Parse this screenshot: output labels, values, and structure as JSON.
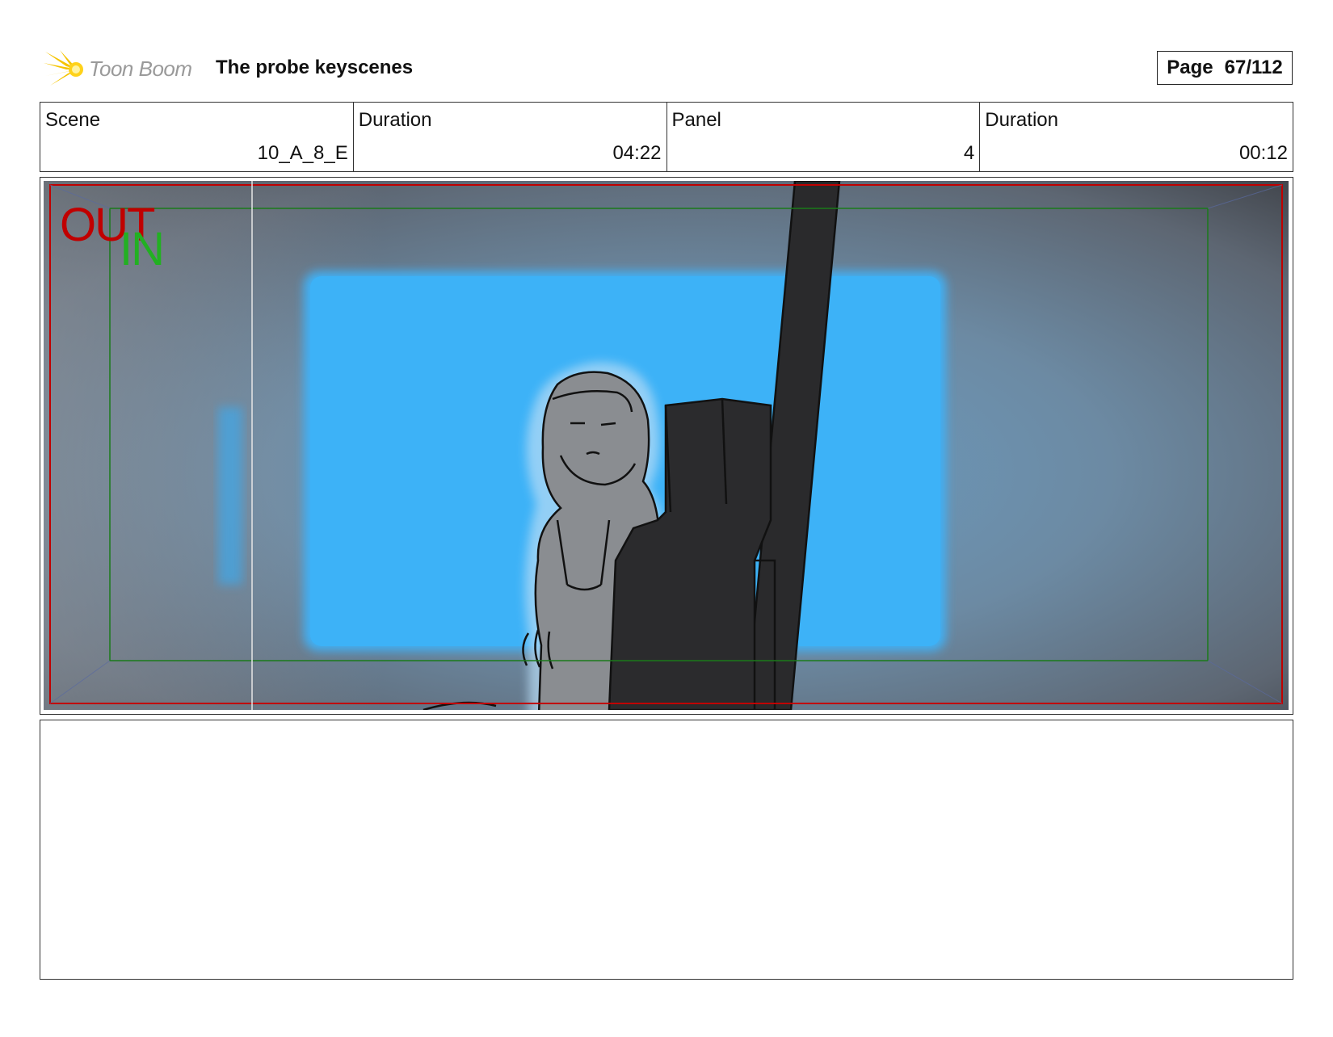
{
  "header": {
    "logo_text": "Toon Boom",
    "logo_icon": "starburst-logo-icon",
    "title": "The probe keyscenes",
    "page_label": "Page",
    "page_number": "67/112"
  },
  "info": {
    "scene_label": "Scene",
    "scene_value": "10_A_8_E",
    "scene_duration_label": "Duration",
    "scene_duration_value": "04:22",
    "panel_label": "Panel",
    "panel_value": "4",
    "panel_duration_label": "Duration",
    "panel_duration_value": "00:12"
  },
  "panel": {
    "camera_out_label": "OUT",
    "camera_in_label": "IN",
    "colors": {
      "window_blue": "#3fb0f5",
      "wall_gray": "#7d8893",
      "camera_out_frame": "#c00000",
      "camera_in_frame": "#1a7a1a"
    }
  },
  "caption": {
    "text": ""
  }
}
